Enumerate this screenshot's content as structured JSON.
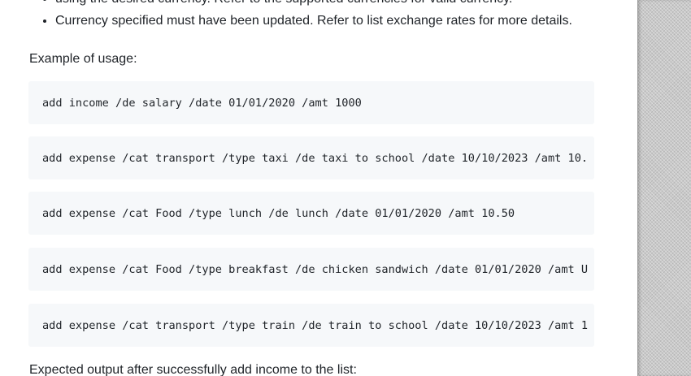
{
  "bullets": [
    "using the desired currency. Refer to the supported currencies for valid currency.",
    "Currency specified must have been updated. Refer to list exchange rates for more details."
  ],
  "example_heading": "Example of usage:",
  "code_examples": [
    "add income /de salary /date 01/01/2020 /amt 1000",
    "add expense /cat transport /type taxi /de taxi to school /date 10/10/2023 /amt 10.",
    "add expense /cat Food /type lunch /de lunch /date 01/01/2020 /amt 10.50",
    "add expense /cat Food /type breakfast /de chicken sandwich /date 01/01/2020 /amt U",
    "add expense /cat transport /type train /de train to school /date 10/10/2023 /amt 1"
  ],
  "expected_output_heading": "Expected output after successfully add income to the list:"
}
